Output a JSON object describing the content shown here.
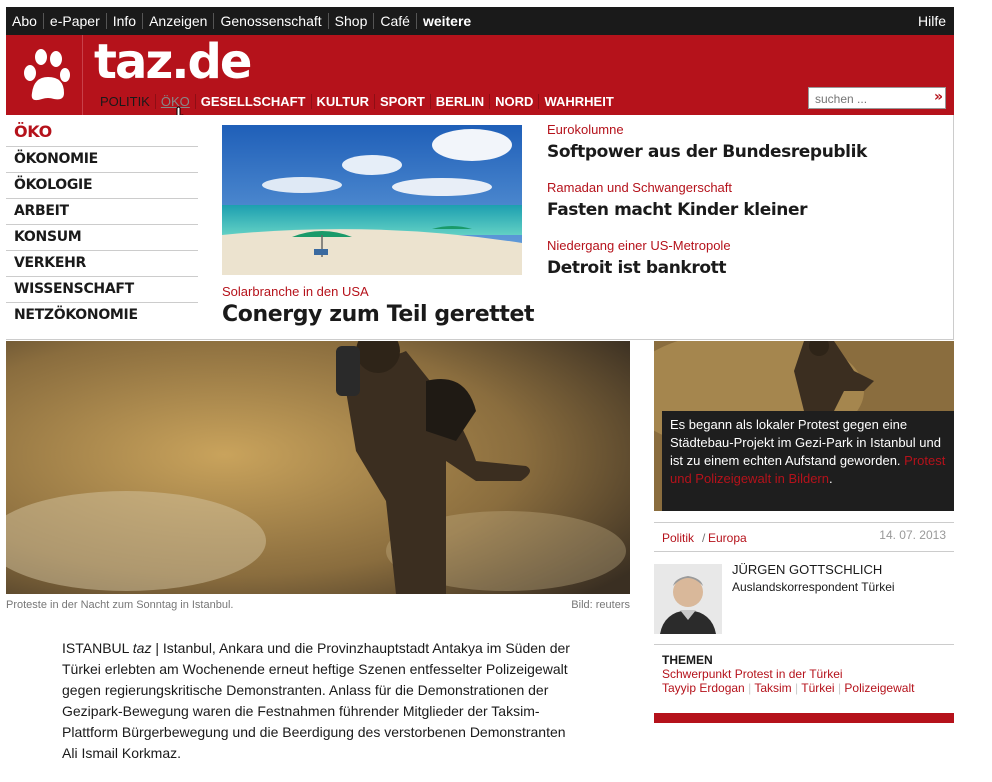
{
  "topbar": {
    "links": [
      "Abo",
      "e-Paper",
      "Info",
      "Anzeigen",
      "Genossenschaft",
      "Shop",
      "Café",
      "weitere"
    ],
    "help": "Hilfe"
  },
  "header": {
    "logo": "taz.de",
    "nav": [
      "POLITIK",
      "ÖKO",
      "GESELLSCHAFT",
      "KULTUR",
      "SPORT",
      "BERLIN",
      "NORD",
      "WAHRHEIT"
    ],
    "active_nav": "ÖKO",
    "search_placeholder": "suchen ...",
    "search_button": "»"
  },
  "dropdown": {
    "subnav": [
      "ÖKO",
      "ÖKONOMIE",
      "ÖKOLOGIE",
      "ARBEIT",
      "KONSUM",
      "VERKEHR",
      "WISSENSCHAFT",
      "NETZÖKONOMIE"
    ],
    "feature": {
      "kicker": "Solarbranche in den USA",
      "headline": "Conergy zum Teil gerettet"
    },
    "teasers": [
      {
        "kicker": "Eurokolumne",
        "headline": "Softpower aus der Bundesrepublik"
      },
      {
        "kicker": "Ramadan und Schwangerschaft",
        "headline": "Fasten macht Kinder kleiner"
      },
      {
        "kicker": "Niedergang einer US-Metropole",
        "headline": "Detroit ist bankrott"
      }
    ]
  },
  "article": {
    "caption": "Proteste in der Nacht zum Sonntag in Istanbul.",
    "credit": "Bild: reuters",
    "dateline": "ISTANBUL",
    "source": "taz",
    "body": "| Istanbul, Ankara und die Provinzhauptstadt Antakya im Süden der Türkei erlebten am Wochenende erneut heftige Szenen entfesselter Polizeigewalt gegen regierungskritische Demonstranten. Anlass für die Demonstrationen der Gezipark-Bewegung waren die Festnahmen führender Mitglieder der Taksim-Plattform Bürgerbewegung und die Beerdigung des verstorbenen Demonstranten Ali Ismail Korkmaz."
  },
  "sidebar": {
    "teaser_text": "Es begann als lokaler Protest gegen eine Städtebau-Projekt im Gezi-Park in Istanbul und ist zu einem echten Aufstand geworden.",
    "teaser_link": "Protest und Polizeigewalt in Bildern",
    "teaser_end": ".",
    "section": "Politik",
    "subsection": "Europa",
    "date": "14. 07. 2013",
    "author_name": "JÜRGEN GOTTSCHLICH",
    "author_role": "Auslandskorrespondent Türkei",
    "themen_title": "THEMEN",
    "themen": [
      "Schwerpunkt Protest in der Türkei",
      "Tayyip Erdogan",
      "Taksim",
      "Türkei",
      "Polizeigewalt"
    ]
  },
  "colors": {
    "brand": "#b5121b",
    "topbar": "#1a1a1a"
  }
}
